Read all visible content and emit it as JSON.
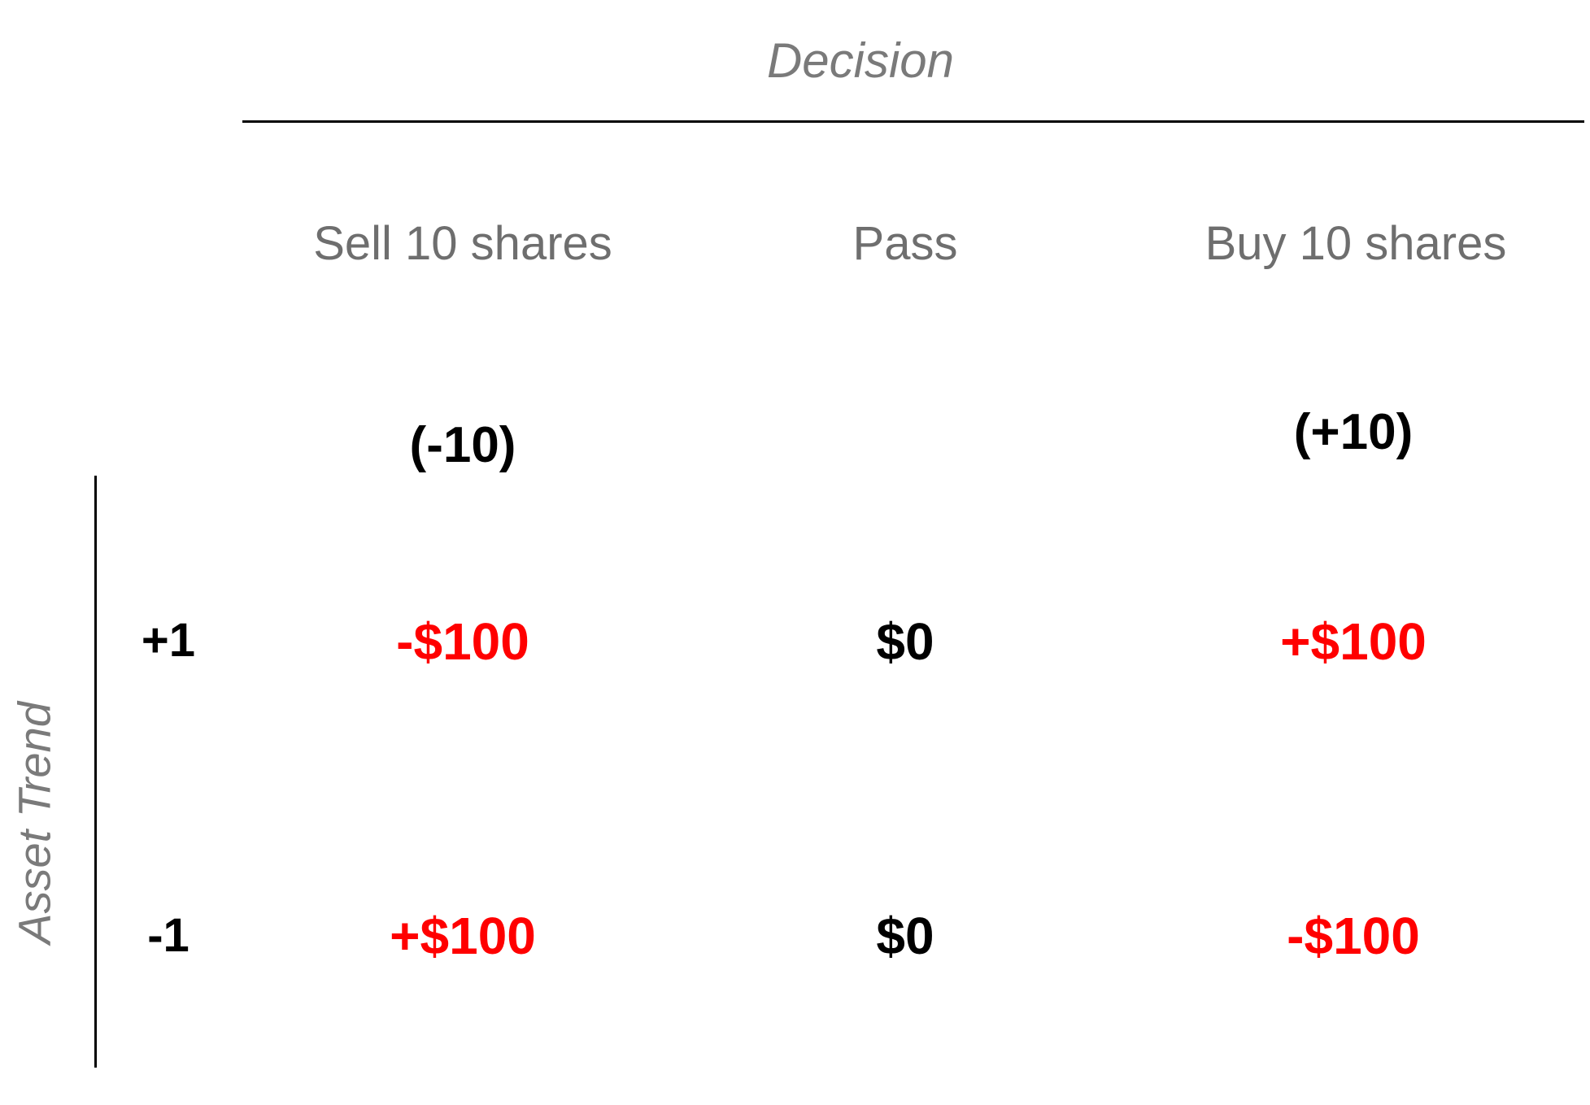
{
  "axes": {
    "column_title": "Decision",
    "row_title": "Asset Trend"
  },
  "decisions": [
    {
      "label": "Sell 10 shares",
      "position": "(-10)"
    },
    {
      "label": "Pass",
      "position": ""
    },
    {
      "label": "Buy 10 shares",
      "position": "(+10)"
    }
  ],
  "rows": [
    {
      "trend": "+1",
      "payoffs": [
        {
          "value": "-$100",
          "color": "#ff0000"
        },
        {
          "value": "$0",
          "color": "#000000"
        },
        {
          "value": "+$100",
          "color": "#ff0000"
        }
      ]
    },
    {
      "trend": "-1",
      "payoffs": [
        {
          "value": "+$100",
          "color": "#ff0000"
        },
        {
          "value": "$0",
          "color": "#000000"
        },
        {
          "value": "-$100",
          "color": "#ff0000"
        }
      ]
    }
  ]
}
